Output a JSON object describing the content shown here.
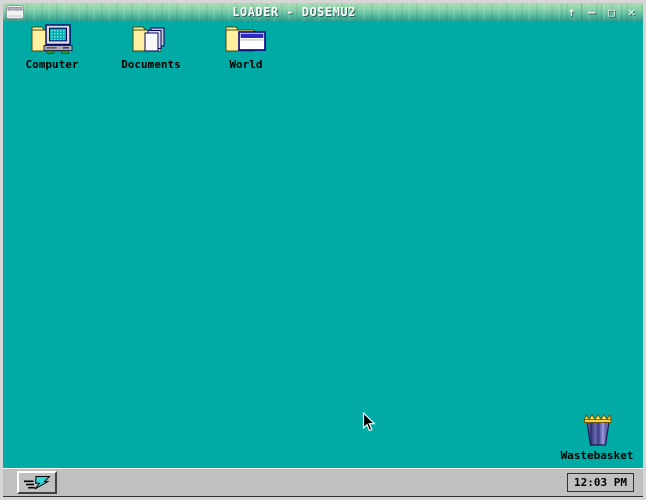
{
  "window": {
    "title": "LOADER - DOSEMU2",
    "controls": {
      "rollup_glyph": "↑",
      "minimize_glyph": "–",
      "maximize_glyph": "□",
      "close_glyph": "✕"
    }
  },
  "desktop": {
    "icons": [
      {
        "name": "computer",
        "label": "Computer"
      },
      {
        "name": "documents",
        "label": "Documents"
      },
      {
        "name": "world",
        "label": "World"
      }
    ],
    "wastebasket": {
      "label": "Wastebasket"
    }
  },
  "taskbar": {
    "clock": "12:03 PM"
  },
  "colors": {
    "desktop_teal": "#00ABA5",
    "titlebar_gradient_top": "#A9DEB7",
    "titlebar_gradient_bottom": "#2F9E90",
    "taskbar_gray": "#C0C0C0",
    "folder_yellow": "#FFF0A0",
    "wastebasket_blue": "#4A4A96",
    "logo_cyan": "#35D6D6"
  }
}
